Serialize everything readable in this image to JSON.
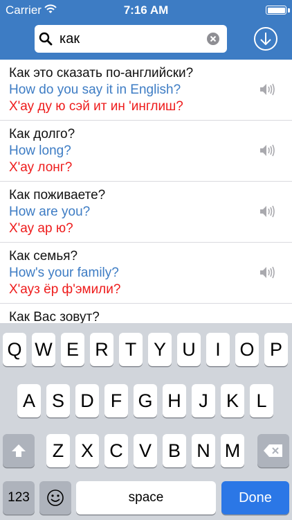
{
  "status_bar": {
    "carrier": "Carrier",
    "time": "7:16 AM"
  },
  "search": {
    "value": "как"
  },
  "phrases": [
    {
      "ru": "Как это сказать по-английски?",
      "en": "How do you say it in English?",
      "translit": "Х'ау ду ю сэй ит ин 'инглиш?"
    },
    {
      "ru": "Как долго?",
      "en": "How long?",
      "translit": "Х'ау лонг?"
    },
    {
      "ru": "Как поживаете?",
      "en": "How are you?",
      "translit": "Х'ау ар ю?"
    },
    {
      "ru": "Как семья?",
      "en": "How's your family?",
      "translit": "Х'ауз ёр ф'эмили?"
    },
    {
      "ru": "Как Вас зовут?"
    }
  ],
  "keyboard": {
    "row1": [
      "Q",
      "W",
      "E",
      "R",
      "T",
      "Y",
      "U",
      "I",
      "O",
      "P"
    ],
    "row2": [
      "A",
      "S",
      "D",
      "F",
      "G",
      "H",
      "J",
      "K",
      "L"
    ],
    "row3": [
      "Z",
      "X",
      "C",
      "V",
      "B",
      "N",
      "M"
    ],
    "numbers_label": "123",
    "space_label": "space",
    "done_label": "Done"
  }
}
